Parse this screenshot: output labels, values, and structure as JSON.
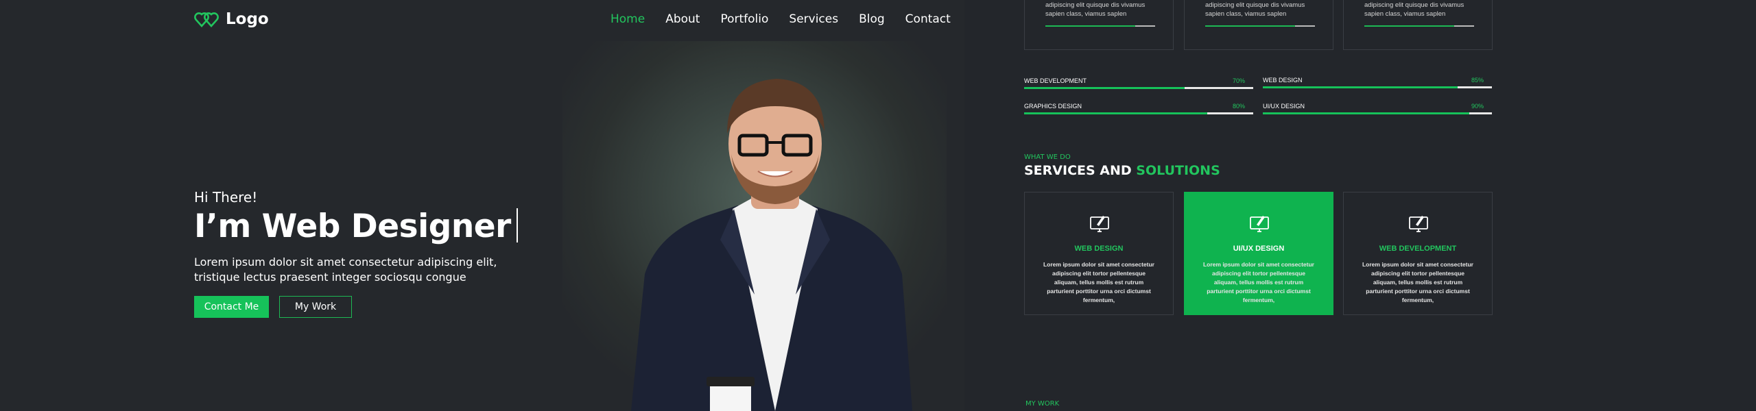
{
  "header": {
    "logo_text": "Logo",
    "nav": [
      {
        "label": "Home",
        "active": true
      },
      {
        "label": "About",
        "active": false
      },
      {
        "label": "Portfolio",
        "active": false
      },
      {
        "label": "Services",
        "active": false
      },
      {
        "label": "Blog",
        "active": false
      },
      {
        "label": "Contact",
        "active": false
      }
    ]
  },
  "hero": {
    "greeting": "Hi There!",
    "headline": "I’m Web Designer",
    "lead": "Lorem ipsum dolor sit amet consectetur adipiscing elit, tristique lectus praesent integer sociosqu congue",
    "primary_button": "Contact Me",
    "secondary_button": "My Work"
  },
  "top_cards": [
    {
      "text": "adipiscing elit quisque dis vivamus sapien class, viamus saplen",
      "progress": 0.82
    },
    {
      "text": "adipiscing elit quisque dis vivamus sapien class, viamus saplen",
      "progress": 0.82
    },
    {
      "text": "adipiscing elit quisque dis vivamus sapien class, viamus saplen",
      "progress": 0.82
    }
  ],
  "skills": [
    {
      "name": "WEB DEVELOPMENT",
      "percent": "70%",
      "value": 0.7
    },
    {
      "name": "WEB DESIGN",
      "percent": "85%",
      "value": 0.85
    },
    {
      "name": "GRAPHICS DESIGN",
      "percent": "80%",
      "value": 0.8
    },
    {
      "name": "UI/UX DESIGN",
      "percent": "90%",
      "value": 0.9
    }
  ],
  "services": {
    "eyebrow": "WHAT WE DO",
    "title_main": "SERVICES AND",
    "title_accent": "SOLUTIONS",
    "items": [
      {
        "title": "WEB DESIGN",
        "desc": "Lorem ipsum dolor sit amet consectetur adipiscing elit tortor pellentesque aliquam, tellus mollis est rutrum parturient porttitor urna orci dictumst fermentum,",
        "active": false
      },
      {
        "title": "UI/UX DESIGN",
        "desc": "Lorem ipsum dolor sit amet consectetur adipiscing elit tortor pellentesque aliquam, tellus mollis est rutrum parturient porttitor urna orci dictumst fermentum,",
        "active": true
      },
      {
        "title": "WEB DEVELOPMENT",
        "desc": "Lorem ipsum dolor sit amet consectetur adipiscing elit tortor pellentesque aliquam, tellus mollis est rutrum parturient porttitor urna orci dictumst fermentum,",
        "active": false
      }
    ]
  },
  "my_work": {
    "eyebrow": "MY WORK"
  },
  "colors": {
    "accent": "#16c25a",
    "background": "#23262b"
  },
  "icons": [
    "logo-hearts-icon",
    "monitor-pen-icon"
  ]
}
